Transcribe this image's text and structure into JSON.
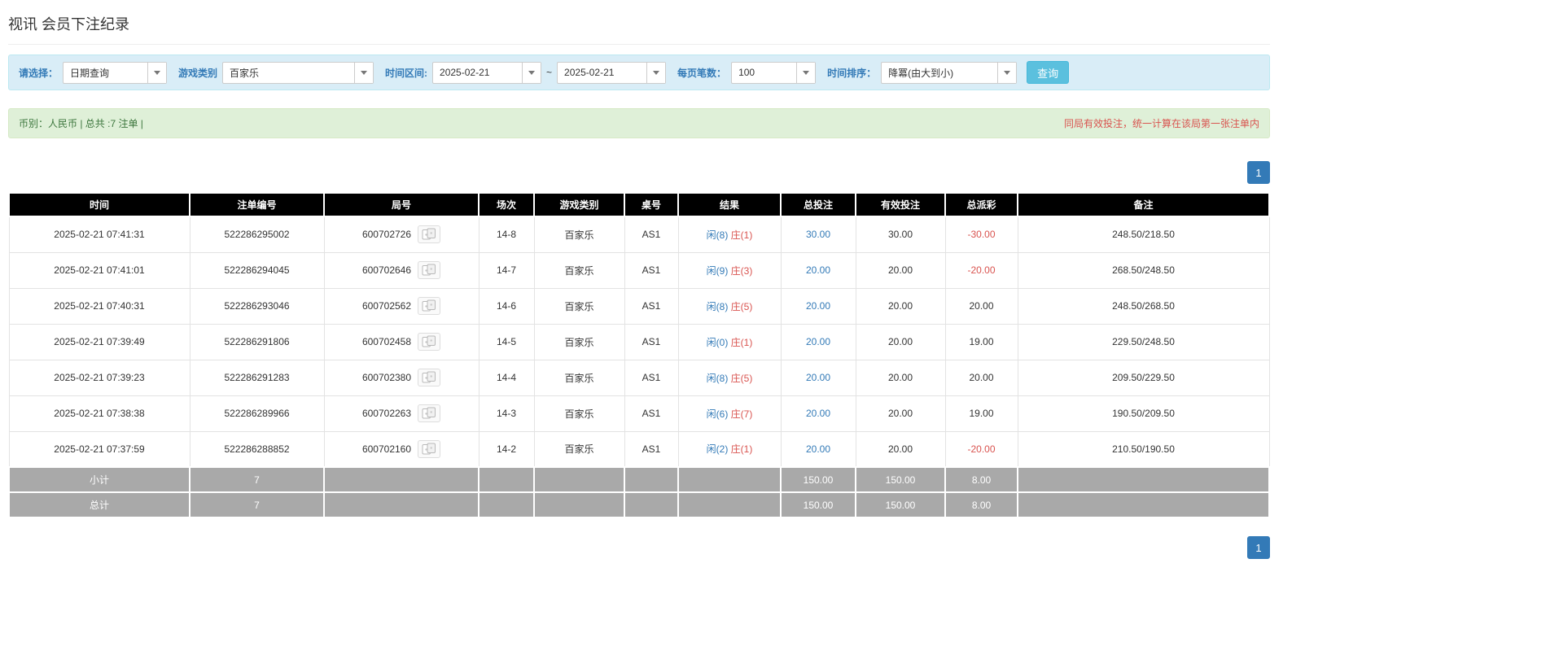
{
  "page": {
    "title": "视讯 会员下注纪录"
  },
  "filter_bar": {
    "choose_label": "请选择：",
    "choose_value": "日期查询",
    "game_type_label": "游戏类别",
    "game_type_value": "百家乐",
    "date_range_label": "时间区间:",
    "date_from": "2025-02-21",
    "tilde": "~",
    "date_to": "2025-02-21",
    "page_size_label": "每页笔数：",
    "page_size_value": "100",
    "sort_label": "时间排序：",
    "sort_value": "降冪(由大到小)",
    "search_button_label": "查询"
  },
  "summary_bar": {
    "info": "币别：人民币 | 总共 :7 注单 |",
    "notice": "同局有效投注，统一计算在该局第一张注单内"
  },
  "pagination": {
    "current_page": "1"
  },
  "table": {
    "headers": [
      "时间",
      "注单编号",
      "局号",
      "场次",
      "游戏类别",
      "桌号",
      "结果",
      "总投注",
      "有效投注",
      "总派彩",
      "备注"
    ],
    "rows": [
      {
        "time": "2025-02-21 07:41:31",
        "bet_id": "522286295002",
        "round_id": "600702726",
        "session": "14-8",
        "game_type": "百家乐",
        "table_id": "AS1",
        "result_player": "闲(8)",
        "result_banker": "庄(1)",
        "total_bet": "30.00",
        "valid_bet": "30.00",
        "payout": "-30.00",
        "note": "248.50/218.50"
      },
      {
        "time": "2025-02-21 07:41:01",
        "bet_id": "522286294045",
        "round_id": "600702646",
        "session": "14-7",
        "game_type": "百家乐",
        "table_id": "AS1",
        "result_player": "闲(9)",
        "result_banker": "庄(3)",
        "total_bet": "20.00",
        "valid_bet": "20.00",
        "payout": "-20.00",
        "note": "268.50/248.50"
      },
      {
        "time": "2025-02-21 07:40:31",
        "bet_id": "522286293046",
        "round_id": "600702562",
        "session": "14-6",
        "game_type": "百家乐",
        "table_id": "AS1",
        "result_player": "闲(8)",
        "result_banker": "庄(5)",
        "total_bet": "20.00",
        "valid_bet": "20.00",
        "payout": "20.00",
        "note": "248.50/268.50"
      },
      {
        "time": "2025-02-21 07:39:49",
        "bet_id": "522286291806",
        "round_id": "600702458",
        "session": "14-5",
        "game_type": "百家乐",
        "table_id": "AS1",
        "result_player": "闲(0)",
        "result_banker": "庄(1)",
        "total_bet": "20.00",
        "valid_bet": "20.00",
        "payout": "19.00",
        "note": "229.50/248.50"
      },
      {
        "time": "2025-02-21 07:39:23",
        "bet_id": "522286291283",
        "round_id": "600702380",
        "session": "14-4",
        "game_type": "百家乐",
        "table_id": "AS1",
        "result_player": "闲(8)",
        "result_banker": "庄(5)",
        "total_bet": "20.00",
        "valid_bet": "20.00",
        "payout": "20.00",
        "note": "209.50/229.50"
      },
      {
        "time": "2025-02-21 07:38:38",
        "bet_id": "522286289966",
        "round_id": "600702263",
        "session": "14-3",
        "game_type": "百家乐",
        "table_id": "AS1",
        "result_player": "闲(6)",
        "result_banker": "庄(7)",
        "total_bet": "20.00",
        "valid_bet": "20.00",
        "payout": "19.00",
        "note": "190.50/209.50"
      },
      {
        "time": "2025-02-21 07:37:59",
        "bet_id": "522286288852",
        "round_id": "600702160",
        "session": "14-2",
        "game_type": "百家乐",
        "table_id": "AS1",
        "result_player": "闲(2)",
        "result_banker": "庄(1)",
        "total_bet": "20.00",
        "valid_bet": "20.00",
        "payout": "-20.00",
        "note": "210.50/190.50"
      }
    ],
    "subtotal_row": {
      "label": "小计",
      "count": "7",
      "total_bet": "150.00",
      "valid_bet": "150.00",
      "payout": "8.00"
    },
    "total_row": {
      "label": "总计",
      "count": "7",
      "total_bet": "150.00",
      "valid_bet": "150.00",
      "payout": "8.00"
    }
  },
  "colors": {
    "accent_blue": "#337ab7",
    "danger_red": "#d9534f",
    "header_black": "#000000",
    "footer_gray": "#a9a9a9",
    "filter_bg": "#d9edf7",
    "summary_bg": "#dff0d8",
    "search_button_bg": "#5bc0de"
  }
}
